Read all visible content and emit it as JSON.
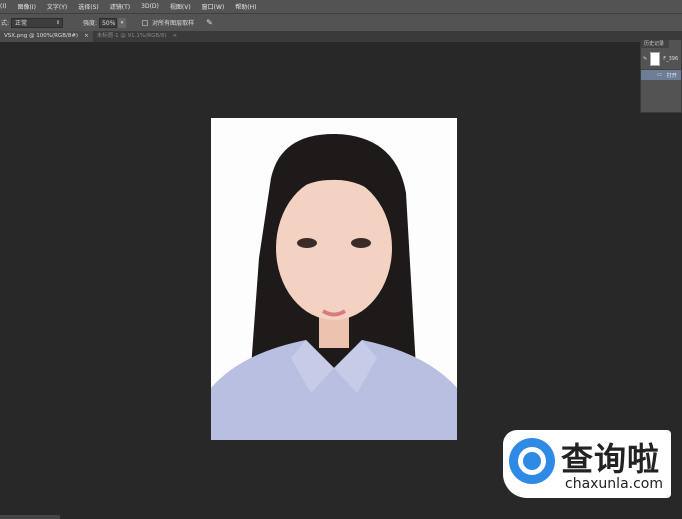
{
  "menu": [
    "(I)",
    "图像(I)",
    "文字(Y)",
    "选择(S)",
    "滤镜(T)",
    "3D(D)",
    "视图(V)",
    "窗口(W)",
    "帮助(H)"
  ],
  "options": {
    "mode_label": "式:",
    "mode_value": "正常",
    "strength_label": "强度:",
    "strength_value": "50%",
    "sample_all_label": "对所有图层取样"
  },
  "tabs": [
    {
      "label": "VSX.png @ 100%(RGB/8#)",
      "close": "×"
    },
    {
      "label": "未标题-1 @ 91.1%(RGB/8)",
      "close": "×"
    }
  ],
  "history_panel": {
    "title": "历史记录",
    "snapshot": "F_396",
    "step": "打开"
  },
  "watermark": {
    "cn": "查询啦",
    "en": "chaxunla.com"
  }
}
